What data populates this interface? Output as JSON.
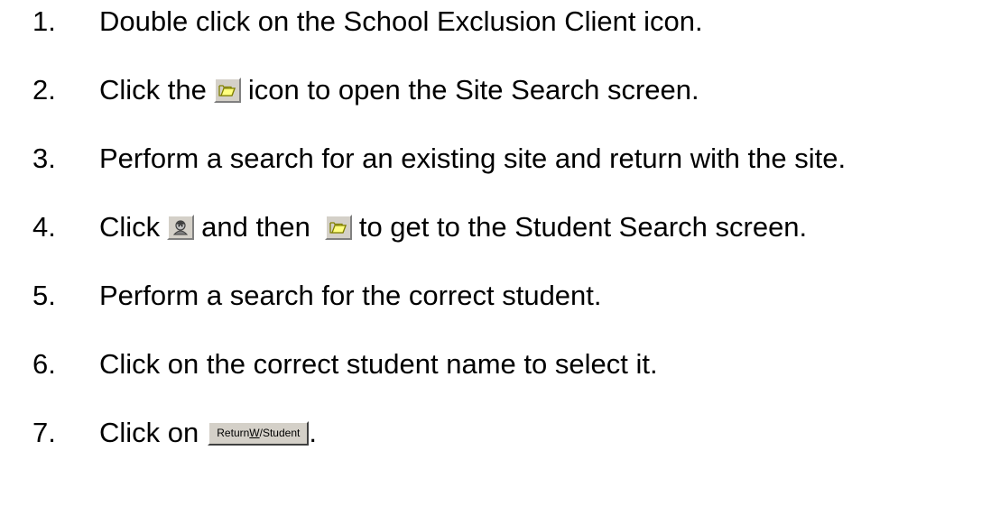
{
  "steps": [
    {
      "number": "1.",
      "text": "Double click on the School Exclusion Client icon."
    },
    {
      "number": "2.",
      "before": "Click the",
      "after": "icon to open the Site Search screen.",
      "icon": "folder-open-icon"
    },
    {
      "number": "3.",
      "text": "Perform a search for an existing site and return with the site."
    },
    {
      "number": "4.",
      "before": "Click",
      "middle": "and then",
      "after": "to get to the Student Search screen.",
      "icons": [
        "student-icon",
        "folder-open-icon"
      ]
    },
    {
      "number": "5.",
      "text": "Perform a search for the correct student."
    },
    {
      "number": "6.",
      "text": "Click on the correct student name to select it."
    },
    {
      "number": "7.",
      "before": "Click on",
      "after": ".",
      "button": {
        "pre": "Return ",
        "underlined": "W",
        "post": "/Student"
      }
    }
  ],
  "colors": {
    "button_face": "#d4d0c8",
    "folder_yellow": "#ffff80",
    "icon_outline": "#808000"
  }
}
